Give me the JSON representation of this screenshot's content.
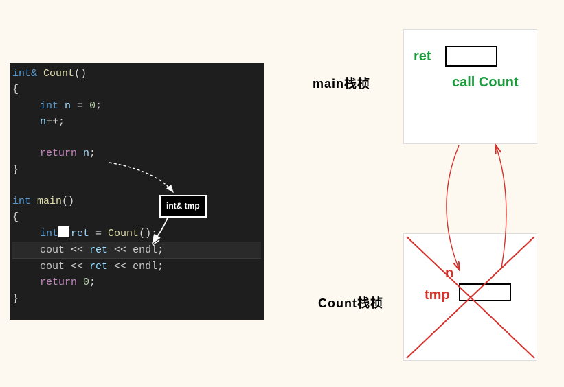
{
  "code": {
    "l1_type": "int&",
    "l1_fn": "Count",
    "l1_paren": "()",
    "l2": "{",
    "l3_type": "int",
    "l3_var": "n",
    "l3_eq": " = ",
    "l3_val": "0",
    "l3_semi": ";",
    "l4_var": "n",
    "l4_op": "++;",
    "l6_kw": "return",
    "l6_var": "n",
    "l6_semi": ";",
    "l7": "}",
    "l9_type": "int",
    "l9_fn": "main",
    "l9_paren": "()",
    "l10": "{",
    "l11_type": "int",
    "l11_var": "ret",
    "l11_eq": " = ",
    "l11_call": "Count",
    "l11_tail": "();",
    "l12_cout": "cout",
    "l12_op1": " << ",
    "l12_var": "ret",
    "l12_op2": " << ",
    "l12_endl": "endl",
    "l12_semi": ";",
    "l13_cout": "cout",
    "l13_op1": " << ",
    "l13_var": "ret",
    "l13_op2": " << ",
    "l13_endl": "endl",
    "l13_semi": ";",
    "l14_kw": "return",
    "l14_val": "0",
    "l14_semi": ";",
    "l15": "}"
  },
  "annotations": {
    "tmp_box_label": "int& tmp"
  },
  "frames": {
    "main_label": "main栈桢",
    "count_label": "Count栈桢",
    "main_ret": "ret",
    "main_call": "call Count",
    "count_n": "n",
    "count_tmp": "tmp"
  }
}
